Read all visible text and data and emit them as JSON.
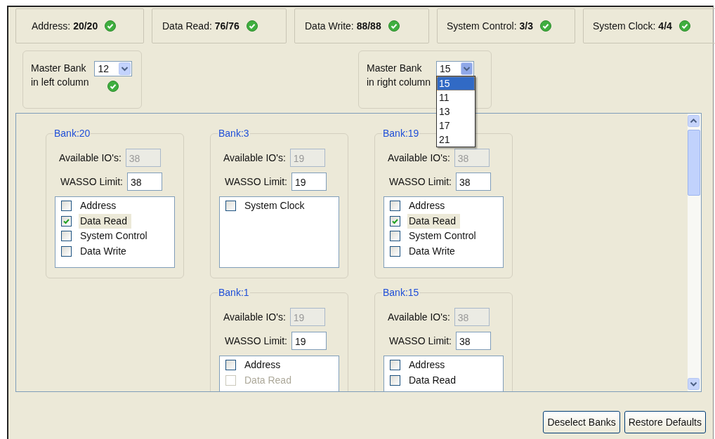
{
  "status_items": [
    {
      "label": "Address:",
      "value": "20/20",
      "ok": true
    },
    {
      "label": "Data Read:",
      "value": "76/76",
      "ok": true
    },
    {
      "label": "Data Write:",
      "value": "88/88",
      "ok": true
    },
    {
      "label": "System Control:",
      "value": "3/3",
      "ok": true
    },
    {
      "label": "System Clock:",
      "value": "4/4",
      "ok": true
    }
  ],
  "master_banks": [
    {
      "label": "Master Bank\nin left column",
      "value": "12",
      "ok": true,
      "expanded": false
    },
    {
      "label": "Master Bank\nin right column",
      "value": "15",
      "ok": false,
      "expanded": true,
      "options": [
        {
          "label": "15",
          "selected": true
        },
        {
          "label": "11",
          "selected": false
        },
        {
          "label": "13",
          "selected": false
        },
        {
          "label": "17",
          "selected": false
        },
        {
          "label": "21",
          "selected": false
        }
      ]
    }
  ],
  "bank_columns": [
    {
      "banks": [
        {
          "title": "Bank:20",
          "available_label": "Available IO's:",
          "available": "38",
          "wasso_label": "WASSO Limit:",
          "wasso": "38",
          "groups": [
            {
              "label": "Address",
              "checked": false,
              "selected": false,
              "disabled": false
            },
            {
              "label": "Data Read",
              "checked": true,
              "selected": true,
              "disabled": false
            },
            {
              "label": "System Control",
              "checked": false,
              "selected": false,
              "disabled": false
            },
            {
              "label": "Data Write",
              "checked": false,
              "selected": false,
              "disabled": false
            }
          ]
        }
      ]
    },
    {
      "banks": [
        {
          "title": "Bank:3",
          "available_label": "Available IO's:",
          "available": "19",
          "wasso_label": "WASSO Limit:",
          "wasso": "19",
          "groups": [
            {
              "label": "System Clock",
              "checked": false,
              "selected": false,
              "disabled": false
            }
          ]
        },
        {
          "title": "Bank:1",
          "available_label": "Available IO's:",
          "available": "19",
          "wasso_label": "WASSO Limit:",
          "wasso": "19",
          "groups": [
            {
              "label": "Address",
              "checked": false,
              "selected": false,
              "disabled": false
            },
            {
              "label": "Data Read",
              "checked": false,
              "selected": false,
              "disabled": true
            }
          ]
        }
      ]
    },
    {
      "banks": [
        {
          "title": "Bank:19",
          "available_label": "Available IO's:",
          "available": "38",
          "wasso_label": "WASSO Limit:",
          "wasso": "38",
          "groups": [
            {
              "label": "Address",
              "checked": false,
              "selected": false,
              "disabled": false
            },
            {
              "label": "Data Read",
              "checked": true,
              "selected": true,
              "disabled": false
            },
            {
              "label": "System Control",
              "checked": false,
              "selected": false,
              "disabled": false
            },
            {
              "label": "Data Write",
              "checked": false,
              "selected": false,
              "disabled": false
            }
          ]
        },
        {
          "title": "Bank:15",
          "available_label": "Available IO's:",
          "available": "38",
          "wasso_label": "WASSO Limit:",
          "wasso": "38",
          "groups": [
            {
              "label": "Address",
              "checked": false,
              "selected": false,
              "disabled": false
            },
            {
              "label": "Data Read",
              "checked": false,
              "selected": false,
              "disabled": false
            }
          ]
        }
      ]
    }
  ],
  "buttons": [
    "Deselect Banks",
    "Restore Defaults"
  ]
}
